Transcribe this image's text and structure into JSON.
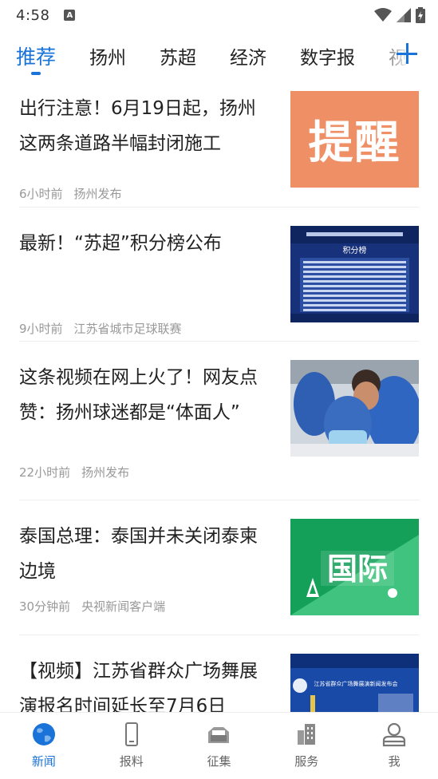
{
  "status_bar": {
    "time": "4:58",
    "notification_badge": "A"
  },
  "tabs": [
    {
      "label": "推荐",
      "active": true
    },
    {
      "label": "扬州",
      "active": false
    },
    {
      "label": "苏超",
      "active": false
    },
    {
      "label": "经济",
      "active": false
    },
    {
      "label": "数字报",
      "active": false
    },
    {
      "label": "视",
      "active": false
    }
  ],
  "accent_color": "#1a73d9",
  "news": [
    {
      "title": "出行注意！6月19日起，扬州这两条道路半幅封闭施工",
      "time": "6小时前",
      "source": "扬州发布",
      "thumb_text": "提醒",
      "thumb_icon": "reminder-banner"
    },
    {
      "title": "最新！“苏超”积分榜公布",
      "time": "9小时前",
      "source": "江苏省城市足球联赛",
      "thumb_text": "积分榜",
      "thumb_icon": "standings-table"
    },
    {
      "title": "这条视频在网上火了！网友点赞：扬州球迷都是“体面人”",
      "time": "22小时前",
      "source": "扬州发布",
      "thumb_icon": "fans-photo"
    },
    {
      "title": "泰国总理：泰国并未关闭泰柬边境",
      "time": "30分钟前",
      "source": "央视新闻客户端",
      "thumb_text": "国际",
      "thumb_icon": "international-banner"
    },
    {
      "title": "【视频】江苏省群众广场舞展演报名时间延长至7月6日",
      "thumb_text": "江苏省群众广场舞展演新闻发布会",
      "thumb_icon": "press-conference-photo"
    }
  ],
  "bottom_nav": [
    {
      "label": "新闻",
      "icon": "globe-icon",
      "active": true
    },
    {
      "label": "报料",
      "icon": "phone-icon",
      "active": false
    },
    {
      "label": "征集",
      "icon": "inbox-icon",
      "active": false
    },
    {
      "label": "服务",
      "icon": "building-icon",
      "active": false
    },
    {
      "label": "我",
      "icon": "user-icon",
      "active": false
    }
  ]
}
